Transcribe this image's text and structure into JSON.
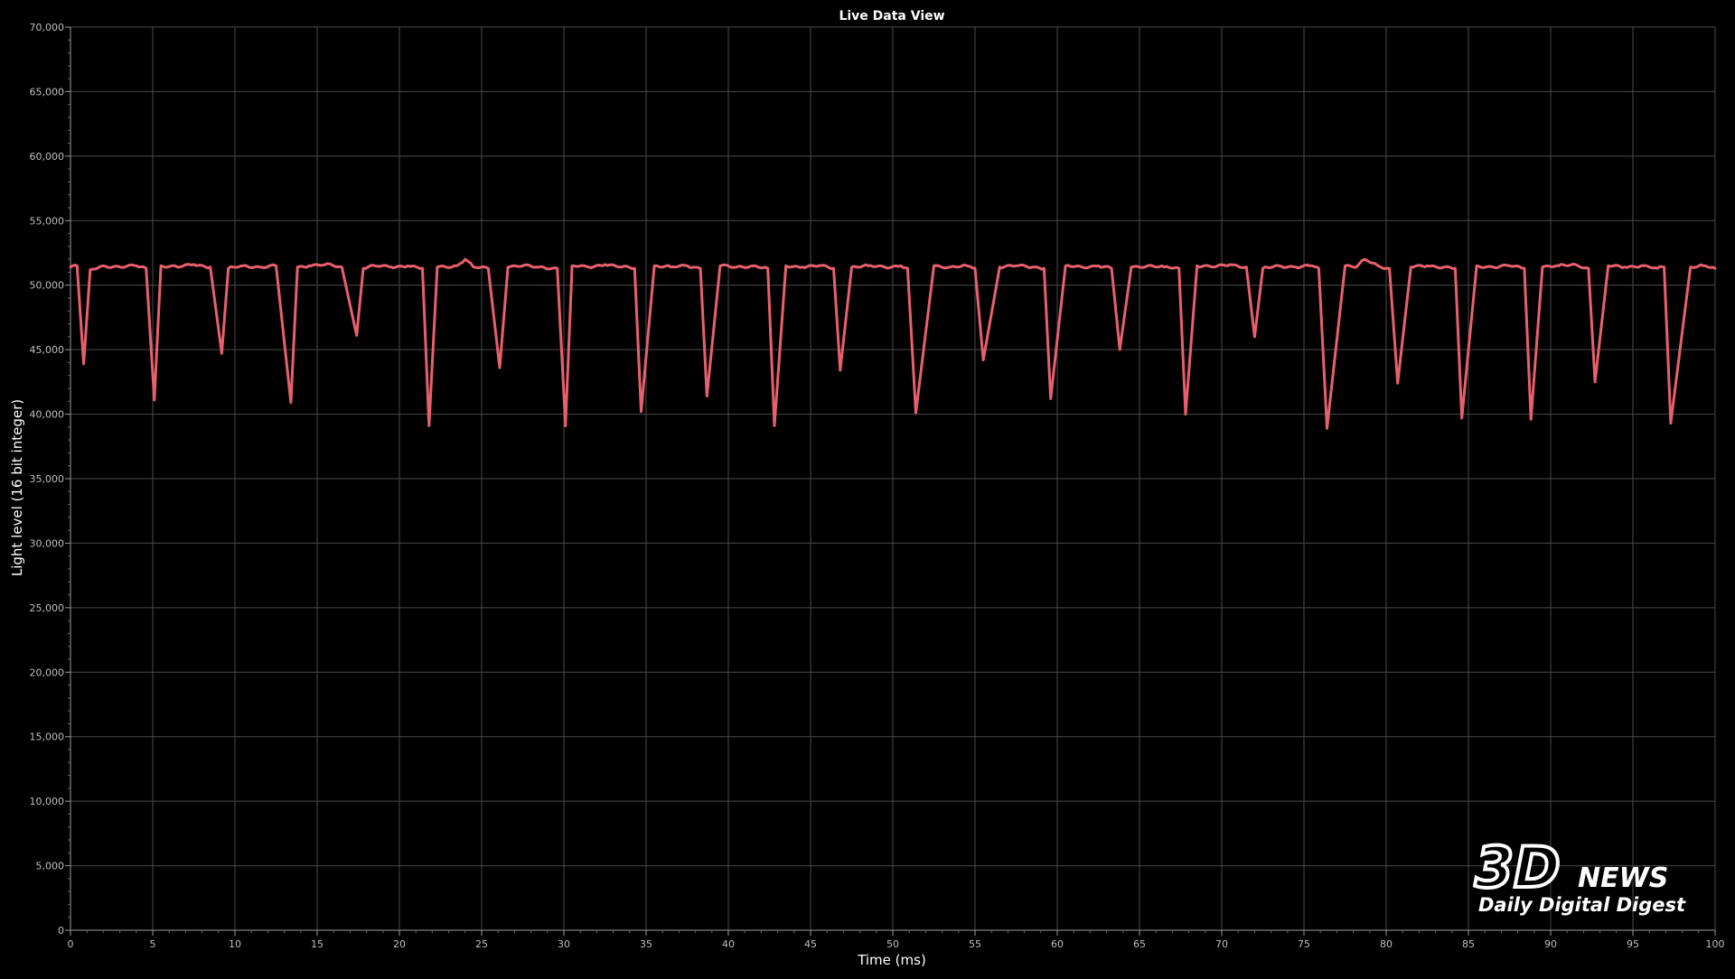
{
  "chart_data": {
    "type": "line",
    "title": "Live Data View",
    "xlabel": "Time (ms)",
    "ylabel": "Light level (16 bit integer)",
    "xlim": [
      0,
      100
    ],
    "ylim": [
      0,
      70000
    ],
    "x_ticks": [
      "0",
      "5",
      "10",
      "15",
      "20",
      "25",
      "30",
      "35",
      "40",
      "45",
      "50",
      "55",
      "60",
      "65",
      "70",
      "75",
      "80",
      "85",
      "90",
      "95",
      "100"
    ],
    "y_ticks": [
      "0",
      "5,000",
      "10,000",
      "15,000",
      "20,000",
      "25,000",
      "30,000",
      "35,000",
      "40,000",
      "45,000",
      "50,000",
      "55,000",
      "60,000",
      "65,000",
      "70,000"
    ],
    "grid": true,
    "legend": "none",
    "series": [
      {
        "color": "#e8606e",
        "baseline": 51500,
        "x": [
          0,
          0.4,
          0.8,
          1.2,
          2.0,
          3.0,
          4.0,
          4.6,
          5.1,
          5.5,
          6.5,
          7.5,
          8.5,
          9.2,
          9.6,
          10.5,
          11.5,
          12.5,
          13.4,
          13.8,
          14.5,
          15.5,
          16.5,
          17.4,
          17.8,
          18.5,
          19.5,
          20.5,
          21.4,
          21.8,
          22.3,
          23.5,
          24.0,
          24.5,
          25.4,
          26.1,
          26.6,
          27.5,
          28.5,
          29.6,
          30.1,
          30.5,
          31.5,
          32.5,
          33.5,
          34.3,
          34.7,
          35.5,
          36.5,
          37.5,
          38.3,
          38.7,
          39.5,
          40.5,
          41.5,
          42.4,
          42.8,
          43.5,
          44.5,
          45.5,
          46.4,
          46.8,
          47.5,
          48.5,
          49.5,
          50.5,
          50.9,
          51.4,
          52.5,
          53.5,
          54.5,
          55.0,
          55.5,
          56.5,
          57.5,
          58.5,
          59.2,
          59.6,
          60.5,
          61.5,
          62.5,
          63.3,
          63.8,
          64.5,
          65.5,
          66.5,
          67.4,
          67.8,
          68.5,
          69.5,
          70.5,
          71.5,
          72.0,
          72.5,
          73.5,
          74.5,
          75.5,
          75.9,
          76.4,
          77.5,
          78.2,
          78.7,
          79.5,
          80.2,
          80.7,
          81.5,
          82.5,
          83.5,
          84.2,
          84.6,
          85.5,
          86.5,
          87.5,
          88.4,
          88.8,
          89.5,
          90.5,
          91.5,
          92.3,
          92.7,
          93.5,
          94.5,
          95.5,
          96.5,
          96.9,
          97.3,
          98.5,
          99.3,
          100
        ],
        "y": [
          51400,
          51500,
          43900,
          51200,
          51500,
          51400,
          51500,
          51300,
          41100,
          51500,
          51400,
          51600,
          51400,
          44700,
          51300,
          51500,
          51400,
          51500,
          40900,
          51400,
          51500,
          51600,
          51400,
          46100,
          51300,
          51500,
          51400,
          51500,
          51300,
          39100,
          51400,
          51500,
          52000,
          51400,
          51300,
          43600,
          51400,
          51500,
          51400,
          51300,
          39100,
          51500,
          51400,
          51600,
          51400,
          51300,
          40200,
          51500,
          51400,
          51500,
          51300,
          41400,
          51500,
          51400,
          51500,
          51300,
          39100,
          51500,
          51400,
          51500,
          51300,
          43400,
          51400,
          51500,
          51400,
          51500,
          51300,
          40100,
          51500,
          51400,
          51500,
          51300,
          44200,
          51400,
          51500,
          51400,
          51300,
          41200,
          51500,
          51400,
          51500,
          51300,
          45000,
          51400,
          51500,
          51400,
          51300,
          40000,
          51500,
          51400,
          51600,
          51400,
          46000,
          51300,
          51500,
          51400,
          51500,
          51300,
          38900,
          51500,
          51400,
          52000,
          51500,
          51300,
          42400,
          51400,
          51500,
          51400,
          51300,
          39700,
          51500,
          51400,
          51500,
          51300,
          39600,
          51400,
          51500,
          51600,
          51300,
          42500,
          51500,
          51400,
          51500,
          51300,
          51400,
          39300,
          51400,
          51500,
          51300
        ]
      }
    ]
  },
  "watermark": {
    "logo_text": "3D",
    "logo_subtext": "NEWS",
    "tagline": "Daily Digital Digest"
  }
}
